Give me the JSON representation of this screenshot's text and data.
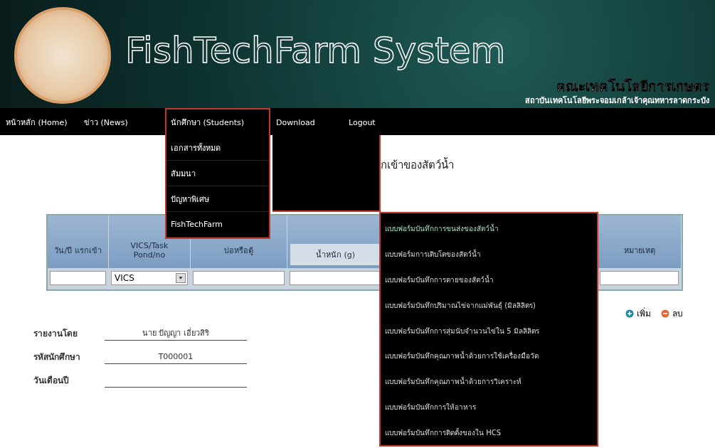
{
  "header": {
    "title": "FishTechFarm System",
    "faculty": "คณะเทคโนโลยีการเกษตร",
    "institute": "สถาบันเทคโนโลยีพระจอมเกล้าเจ้าคุณทหารลาดกระบัง"
  },
  "nav": [
    {
      "label": "หน้าหลัก (Home)",
      "selected": false
    },
    {
      "label": "ข่าว (News)",
      "selected": false
    },
    {
      "label": "นักศึกษา (Students)",
      "selected": true,
      "menu": [
        {
          "label": "เอกสารทั้งหมด"
        },
        {
          "label": "สัมมนา"
        },
        {
          "label": "ปัญหาพิเศษ"
        },
        {
          "label": "FishTechFarm"
        }
      ]
    },
    {
      "label": "Download",
      "selected": false
    },
    {
      "label": "Logout",
      "selected": false
    }
  ],
  "submenu": [
    {
      "label": "แบบฟอร์มบันทึกการขนส่งของสัตว์น้ำ",
      "selected": true
    },
    {
      "label": "แบบฟอร์มการเติบโตของสัตว์น้ำ",
      "selected": false
    },
    {
      "label": "แบบฟอร์มบันทึกการตายของสัตว์น้ำ",
      "selected": false
    },
    {
      "label": "แบบฟอร์มบันทึกปริมาณไข่จากแม่พันธุ์ (มิลลิลิตร)",
      "selected": false
    },
    {
      "label": "แบบฟอร์มบันทึกการสุ่มนับจำนวนไข่ใน 5 มิลลิลิตร",
      "selected": false
    },
    {
      "label": "แบบฟอร์มบันทึกคุณภาพน้ำด้วยการใช้เครื่องมือวัด",
      "selected": false
    },
    {
      "label": "แบบฟอร์มบันทึกคุณภาพน้ำด้วยการวิเคราะห์",
      "selected": false
    },
    {
      "label": "แบบฟอร์มบันทึกการให้อาหาร",
      "selected": false
    },
    {
      "label": "แบบฟอร์มบันทึกการติดตั้งของใน HCS",
      "selected": false
    }
  ],
  "page_title": "กเข้าของสัตว์น้ำ",
  "table": {
    "columns": [
      {
        "label": "วัน/ปี แรกเข้า",
        "kind": "input"
      },
      {
        "label": "VICS/Task Pond/no",
        "kind": "select",
        "value": "VICS"
      },
      {
        "label": "บ่อหรือตู้",
        "kind": "input"
      },
      {
        "label": "น้ำหนัก (g)",
        "kind": "sub"
      },
      {
        "label": "หมายเหตุ",
        "kind": "input"
      }
    ]
  },
  "actions": [
    {
      "label": "เพิ่ม",
      "kind": "add"
    },
    {
      "label": "ลบ",
      "kind": "delete"
    }
  ],
  "report": [
    {
      "label": "รายงานโดย",
      "value": "นาย ปัญญา เอี่ยวสิริ"
    },
    {
      "label": "รหัสนักศึกษา",
      "value": "T000001"
    },
    {
      "label": "วันเดือนปี"
    }
  ]
}
